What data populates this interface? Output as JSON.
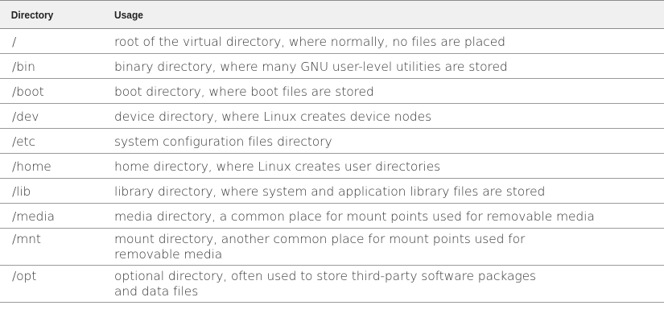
{
  "table": {
    "headers": {
      "directory": "Directory",
      "usage": "Usage"
    },
    "rows": [
      {
        "directory": "/",
        "usage": [
          "root of the virtual directory, where normally, no files are placed"
        ]
      },
      {
        "directory": "/bin",
        "usage": [
          "binary directory, where many GNU user-level utilities are stored"
        ]
      },
      {
        "directory": "/boot",
        "usage": [
          "boot directory, where boot files are stored"
        ]
      },
      {
        "directory": "/dev",
        "usage": [
          "device directory, where Linux creates device nodes"
        ]
      },
      {
        "directory": "/etc",
        "usage": [
          "system configuration files directory"
        ]
      },
      {
        "directory": "/home",
        "usage": [
          "home directory, where Linux creates user directories"
        ]
      },
      {
        "directory": "/lib",
        "usage": [
          "library directory, where system and application library files are stored"
        ]
      },
      {
        "directory": "/media",
        "usage": [
          "media directory, a common place for mount points used for removable media"
        ]
      },
      {
        "directory": "/mnt",
        "usage": [
          "mount directory, another common place for mount points used for",
          "removable media"
        ]
      },
      {
        "directory": "/opt",
        "usage": [
          "optional directory, often used to store third-party software packages",
          "and data files"
        ]
      }
    ]
  }
}
